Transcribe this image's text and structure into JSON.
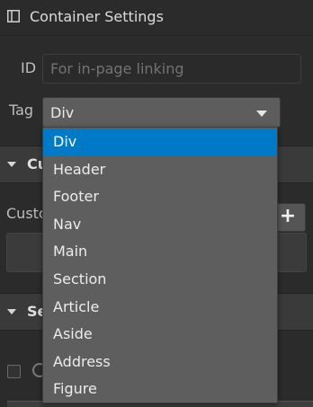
{
  "header": {
    "title": "Container Settings",
    "icon": "panel-icon"
  },
  "id_field": {
    "label": "ID",
    "value": "",
    "placeholder": "For in-page linking"
  },
  "tag_field": {
    "label": "Tag",
    "selected": "Div"
  },
  "background": {
    "section1_title": "Cu",
    "custom_label": "Custo",
    "plus_label": "+",
    "section2_title": "Se"
  },
  "dropdown": {
    "options": [
      "Div",
      "Header",
      "Footer",
      "Nav",
      "Main",
      "Section",
      "Article",
      "Aside",
      "Address",
      "Figure"
    ],
    "selected_index": 0
  },
  "colors": {
    "panel_bg": "#2b2b2b",
    "selected_item": "#007ac7",
    "dropdown_bg": "#5e5e5e"
  }
}
